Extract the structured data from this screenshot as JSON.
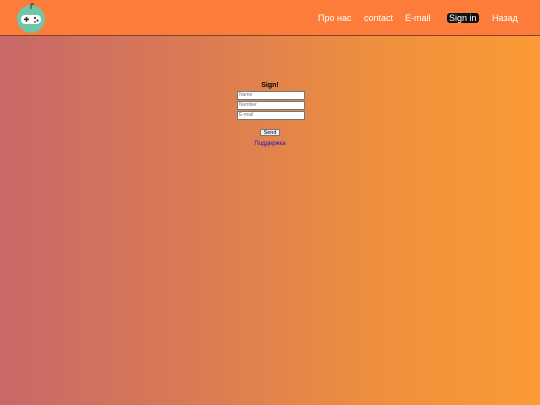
{
  "nav": {
    "items": [
      {
        "label": "Про нас",
        "active": false
      },
      {
        "label": "contact",
        "active": false
      },
      {
        "label": "E-mail",
        "active": false
      },
      {
        "label": "Sign in",
        "active": true
      },
      {
        "label": "Назад",
        "active": false
      }
    ]
  },
  "logo": {
    "icon": "gamepad-icon",
    "color": "#6fc6a8"
  },
  "form": {
    "title": "Sign!",
    "name_placeholder": "Name",
    "name_value": "",
    "number_placeholder": "Number",
    "number_value": "",
    "email_placeholder": "E-mail",
    "email_value": "",
    "send_label": "Send",
    "support_label": "Поддержка"
  },
  "colors": {
    "header": "#fe7c3a",
    "active_nav_bg": "#111111",
    "link": "#1a10c8",
    "background_start": "#c86868",
    "background_end": "#fb9a35"
  }
}
